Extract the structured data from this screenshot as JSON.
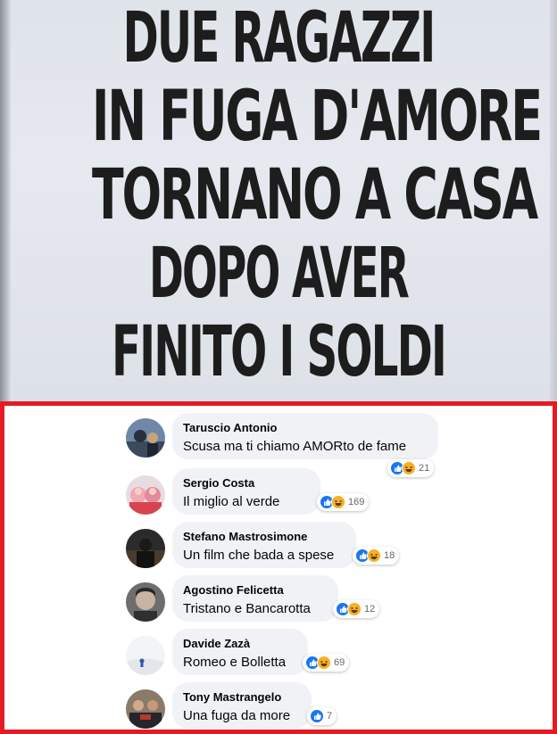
{
  "headline": {
    "lines": [
      "DUE RAGAZZI",
      "IN FUGA D'AMORE",
      "TORNANO A CASA",
      "DOPO AVER",
      "FINITO I SOLDI"
    ]
  },
  "comments": [
    {
      "author": "Taruscio Antonio",
      "text": "Scusa ma ti chiamo AMORto de fame",
      "reactions": [
        "like",
        "haha"
      ],
      "count": "21"
    },
    {
      "author": "Sergio Costa",
      "text": "Il miglio al verde",
      "reactions": [
        "like",
        "haha"
      ],
      "count": "169"
    },
    {
      "author": "Stefano Mastrosimone",
      "text": "Un film che bada a spese",
      "reactions": [
        "like",
        "haha"
      ],
      "count": "18"
    },
    {
      "author": "Agostino Felicetta",
      "text": "Tristano e Bancarotta",
      "reactions": [
        "like",
        "haha"
      ],
      "count": "12"
    },
    {
      "author": "Davide Zazà",
      "text": "Romeo e Bolletta",
      "reactions": [
        "like",
        "haha"
      ],
      "count": "69"
    },
    {
      "author": "Tony Mastrangelo",
      "text": "Una fuga da more",
      "reactions": [
        "like"
      ],
      "count": "7"
    }
  ],
  "colors": {
    "frame_border": "#e41b23",
    "like_blue": "#1877f2",
    "haha_yellow": "#f7b125",
    "bubble_bg": "#f0f2f5"
  }
}
